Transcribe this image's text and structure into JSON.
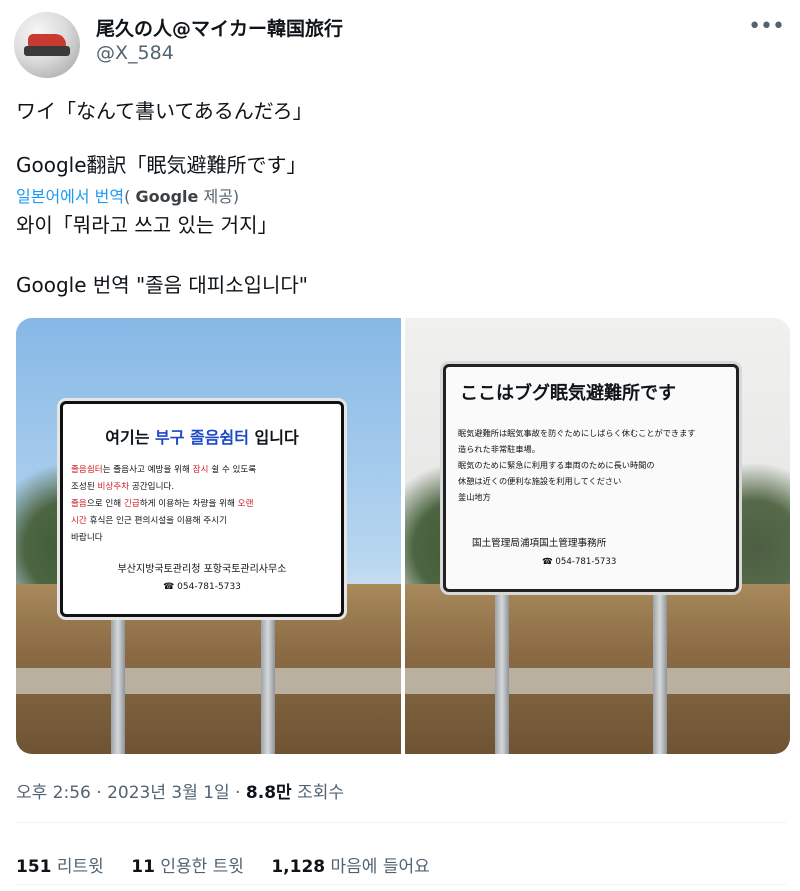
{
  "user": {
    "name": "尾久の人@マイカー韓国旅行",
    "handle": "@X_584"
  },
  "tweet": {
    "line1": "ワイ「なんて書いてあるんだろ」",
    "line2": "Google翻訳「眠気避難所です」",
    "translated_by": "일본어에서 번역",
    "google": "Google",
    "provided": "제공",
    "line3": "와이「뭐라고 쓰고 있는 거지」",
    "line4": "Google 번역 \"졸음 대피소입니다\""
  },
  "sign_korean": {
    "title_pre": "여기는",
    "title_place": "부구 졸음쉼터",
    "title_post": "입니다",
    "l1_red": "졸음쉼터",
    "l1_a": "는 졸음사고 예방을 위해",
    "l1_red2": "잠시",
    "l1_b": "쉴 수 있도록",
    "l2_a": "조성된",
    "l2_red": "비상주차",
    "l2_b": "공간입니다.",
    "l3_red": "졸음",
    "l3_a": "으로 인해",
    "l3_red2": "긴급",
    "l3_b": "하게 이용하는 차량을 위해",
    "l3_red3": "오랜",
    "l4_red": "시간",
    "l4_a": "휴식은 인근 편의시설을 이용해 주시기",
    "l5": "바랍니다",
    "org": "부산지방국토관리청 포항국토관리사무소",
    "tel": "☎ 054-781-5733"
  },
  "sign_japanese": {
    "title": "ここはブグ眠気避難所です",
    "l1": "眠気避難所は眠気事故を防ぐためにしばらく休むことができます",
    "l2": "造られた非常駐車場。",
    "l3": "眠気のために緊急に利用する車両のために長い時間の",
    "l4": "休憩は近くの便利な施設を利用してください",
    "l5": "釜山地方",
    "org": "国土管理局浦項国土管理事務所",
    "tel": "☎ 054-781-5733"
  },
  "meta": {
    "time": "오후 2:56",
    "sep": "·",
    "date": "2023년 3월 1일",
    "views": "8.8만",
    "views_label": "조회수"
  },
  "stats": {
    "retweets_count": "151",
    "retweets_label": "리트윗",
    "quotes_count": "11",
    "quotes_label": "인용한 트윗",
    "likes_count": "1,128",
    "likes_label": "마음에 들어요"
  },
  "icons": {
    "more": "more-horizontal-icon"
  }
}
